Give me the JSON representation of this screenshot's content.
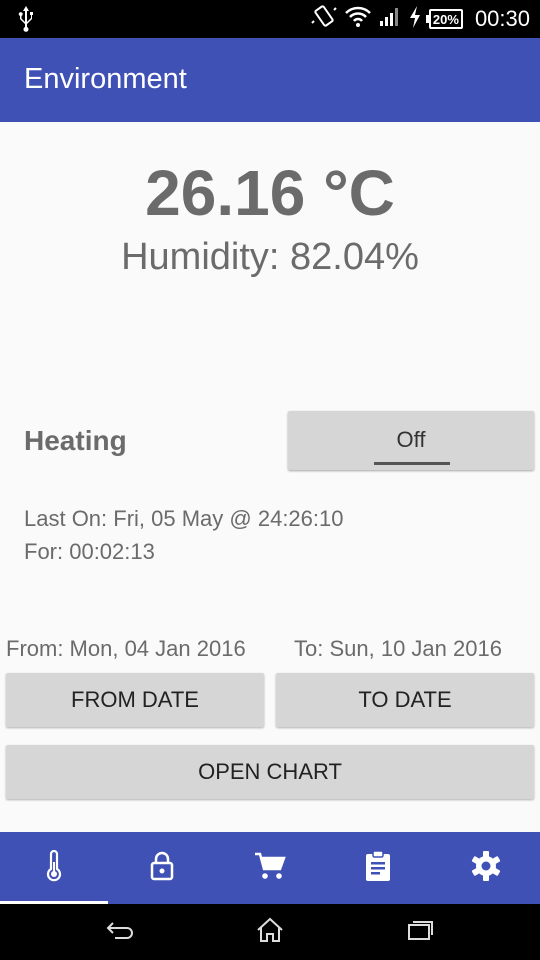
{
  "status_bar": {
    "battery": "20%",
    "time": "00:30",
    "icons": [
      "usb-icon",
      "vibrate-icon",
      "wifi-icon",
      "signal-icon",
      "charging-icon",
      "battery-icon"
    ]
  },
  "app_bar": {
    "title": "Environment"
  },
  "readings": {
    "temperature": "26.16 °C",
    "humidity": "Humidity: 82.04%"
  },
  "heating": {
    "label": "Heating",
    "toggle_label": "Off",
    "last_on": "Last On: Fri, 05 May @ 24:26:10",
    "duration": "For: 00:02:13"
  },
  "range": {
    "from": "From: Mon, 04 Jan 2016",
    "to": "To: Sun, 10 Jan 2016",
    "from_button": "FROM DATE",
    "to_button": "TO DATE",
    "chart_button": "OPEN CHART"
  },
  "bottom_nav": {
    "items": [
      {
        "icon": "thermometer-icon",
        "active": true
      },
      {
        "icon": "lock-icon",
        "active": false
      },
      {
        "icon": "cart-icon",
        "active": false
      },
      {
        "icon": "clipboard-icon",
        "active": false
      },
      {
        "icon": "gear-icon",
        "active": false
      }
    ]
  },
  "system_nav": {
    "icons": [
      "back-icon",
      "home-icon",
      "recents-icon"
    ]
  },
  "colors": {
    "primary": "#3f51b5",
    "text": "#6b6b6b",
    "button": "#d6d6d6"
  }
}
